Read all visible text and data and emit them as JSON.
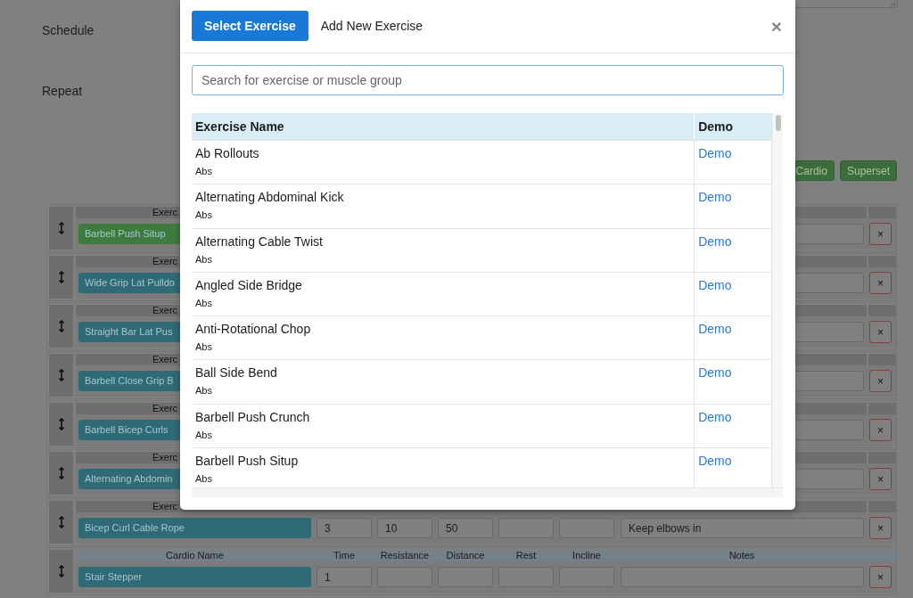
{
  "page": {
    "labels": [
      "Schedule",
      "Repeat"
    ],
    "add_buttons": [
      "Cardio",
      "Superset"
    ],
    "rows": [
      {
        "kind": "exercise",
        "header": "Exerc",
        "name": "Barbell Push Situp",
        "color": "#3f7b3f",
        "remove": "×"
      },
      {
        "kind": "exercise",
        "header": "Exerc",
        "name": "Wide Grip Lat Pulldo",
        "color": "#2f6a77",
        "remove": "×"
      },
      {
        "kind": "exercise",
        "header": "Exerc",
        "name": "Straight Bar Lat Pus",
        "color": "#2f6a77",
        "remove": "×"
      },
      {
        "kind": "exercise",
        "header": "Exerc",
        "name": "Barbell Close Grip B",
        "color": "#2f6a77",
        "remove": "×"
      },
      {
        "kind": "exercise",
        "header": "Exerc",
        "name": "Barbell Bicep Curls",
        "color": "#2f6a77",
        "remove": "×"
      },
      {
        "kind": "exercise",
        "header": "Exerc",
        "name": "Alternating Abdomin",
        "color": "#2f6a77",
        "remove": "×"
      },
      {
        "kind": "exercise",
        "header": "Exerc",
        "name": "Bicep Curl Cable Rope",
        "color": "#2f6a77",
        "values": [
          "3",
          "10",
          "50"
        ],
        "notes": "Keep elbows in",
        "remove": "×"
      },
      {
        "kind": "cardio",
        "headers": [
          "Cardio Name",
          "Time",
          "Resistance",
          "Distance",
          "Rest",
          "Incline",
          "Notes"
        ],
        "name": "Stair Stepper",
        "color": "#2f6a77",
        "values": [
          "1"
        ],
        "remove": "×"
      }
    ]
  },
  "modal": {
    "tabs": [
      {
        "label": "Select Exercise",
        "selected": true
      },
      {
        "label": "Add New Exercise",
        "selected": false
      }
    ],
    "close": "×",
    "search": {
      "placeholder": "Search for exercise or muscle group"
    },
    "table": {
      "columns": [
        "Exercise Name",
        "Demo"
      ],
      "rows": [
        {
          "name": "Ab Rollouts",
          "muscle": "Abs",
          "demo": "Demo"
        },
        {
          "name": "Alternating Abdominal Kick",
          "muscle": "Abs",
          "demo": "Demo"
        },
        {
          "name": "Alternating Cable Twist",
          "muscle": "Abs",
          "demo": "Demo"
        },
        {
          "name": "Angled Side Bridge",
          "muscle": "Abs",
          "demo": "Demo"
        },
        {
          "name": "Anti-Rotational Chop",
          "muscle": "Abs",
          "demo": "Demo"
        },
        {
          "name": "Ball Side Bend",
          "muscle": "Abs",
          "demo": "Demo"
        },
        {
          "name": "Barbell Push Crunch",
          "muscle": "Abs",
          "demo": "Demo"
        },
        {
          "name": "Barbell Push Situp",
          "muscle": "Abs",
          "demo": "Demo"
        }
      ]
    }
  }
}
